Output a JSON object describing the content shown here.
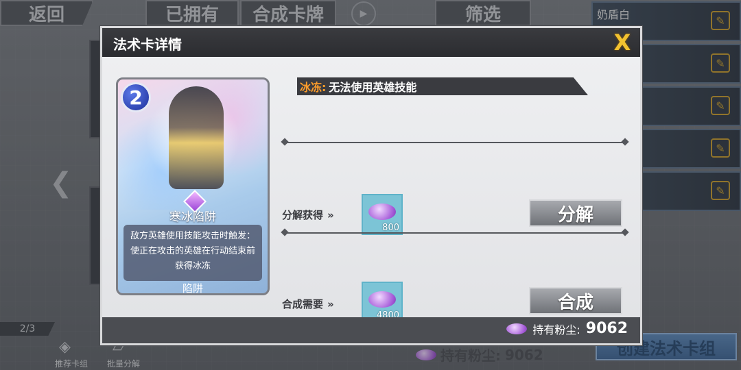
{
  "background": {
    "back_label": "返回",
    "owned_tab": "已拥有",
    "compose_tab": "合成卡牌",
    "filter_tab": "筛选",
    "page_indicator": "2/3",
    "recommend_label": "推荐卡组",
    "batch_label": "批量分解",
    "dust_label": "持有粉尘:",
    "dust_value": "9062",
    "create_deck_label": "创建法术卡组",
    "deck_slots": [
      "奶盾白",
      "",
      "",
      "",
      ""
    ]
  },
  "modal": {
    "title": "法术卡详情",
    "close_label": "X",
    "card": {
      "cost": "2",
      "name": "寒冰陷阱",
      "description": "敌方英雄使用技能攻击时触发：使正在攻击的英雄在行动结束前获得冰冻",
      "type": "陷阱"
    },
    "effect": {
      "name": "冰冻:",
      "text": "无法使用英雄技能"
    },
    "decompose": {
      "label": "分解获得",
      "chevron": "»",
      "amount": "800",
      "button": "分解"
    },
    "compose": {
      "label": "合成需要",
      "chevron": "»",
      "amount": "4800",
      "button": "合成"
    },
    "footer": {
      "dust_label": "持有粉尘:",
      "dust_value": "9062"
    }
  },
  "colors": {
    "effect_accent": "#ff9d2a",
    "close_icon": "#f2c230",
    "dust_purple": "#a55ad8"
  }
}
